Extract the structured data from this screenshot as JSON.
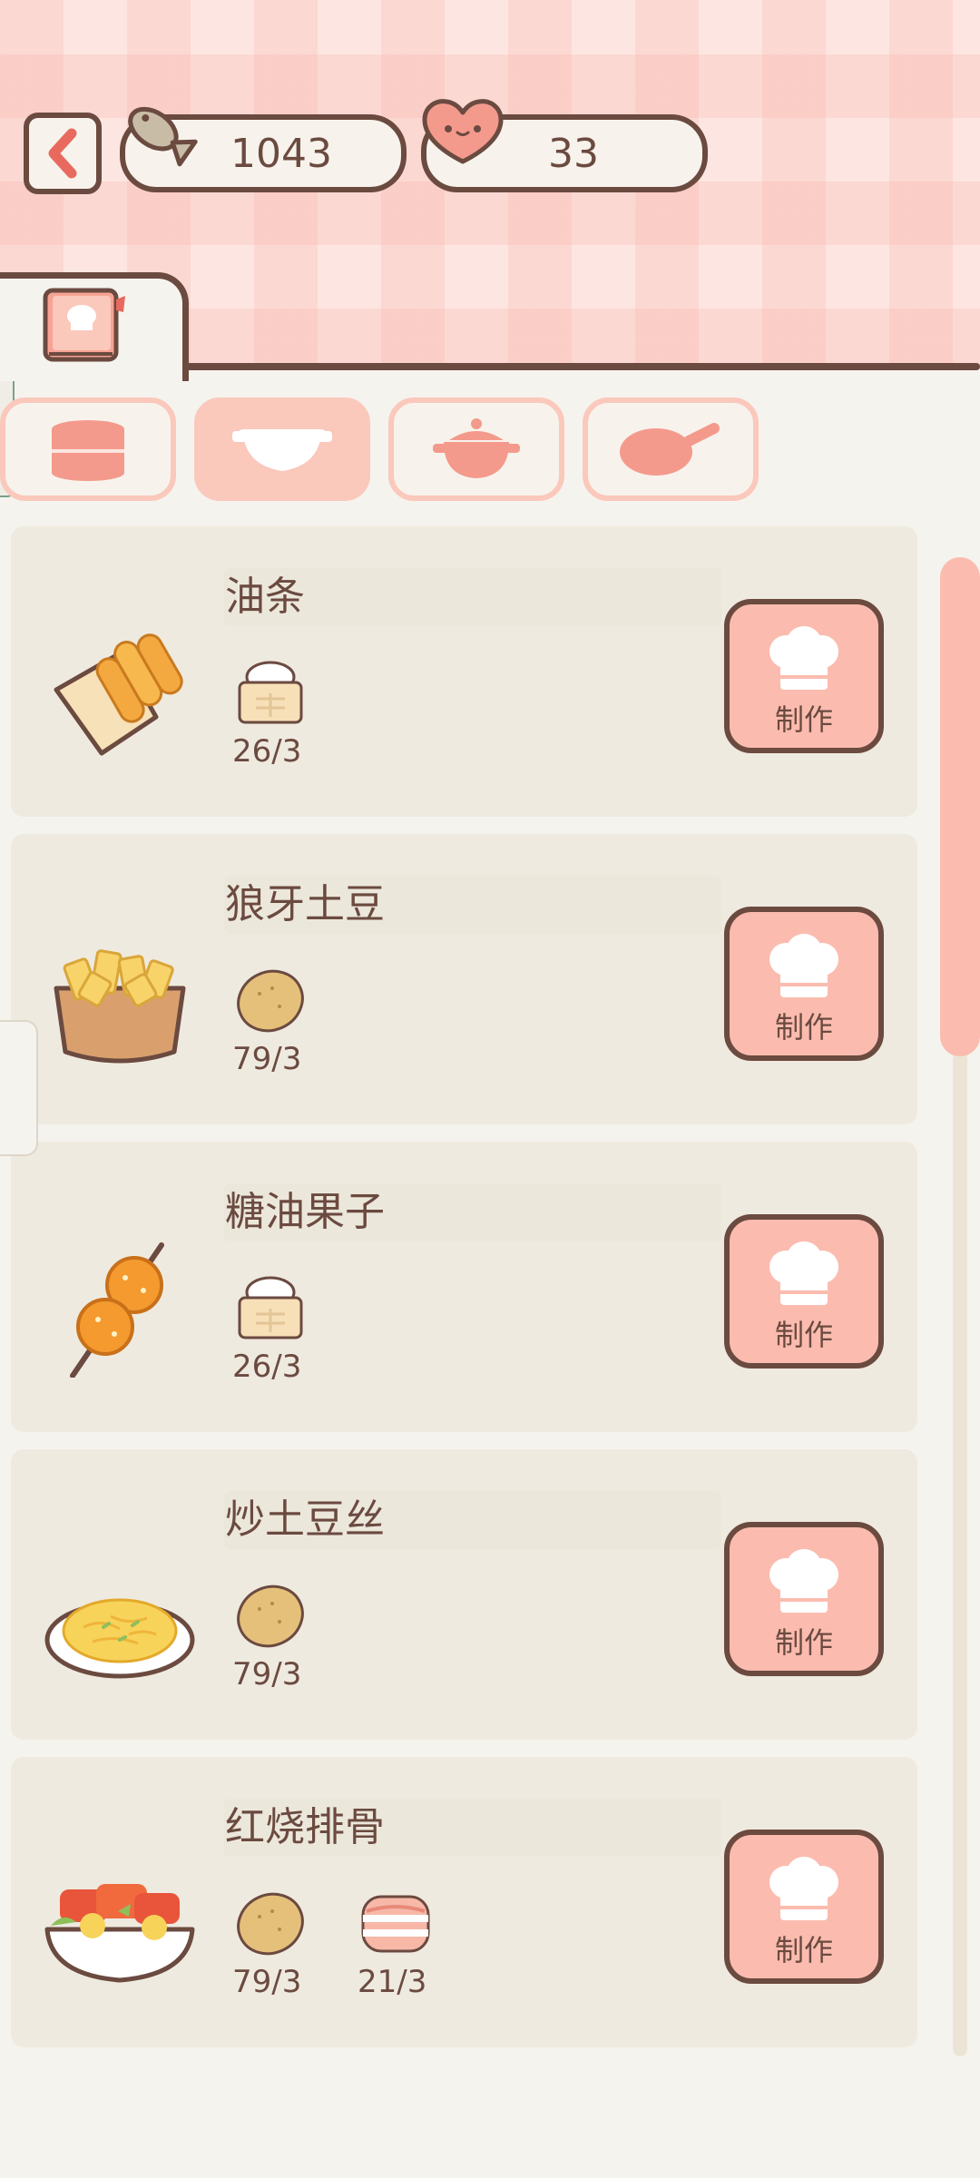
{
  "header": {
    "fish_count": "1043",
    "heart_count": "33"
  },
  "tabs": {
    "active_index": 1,
    "items": [
      "steamer-icon",
      "bowl-icon",
      "pot-icon",
      "pan-icon"
    ]
  },
  "recipes": [
    {
      "name": "油条",
      "food_icon": "youtiao-icon",
      "ingredients": [
        {
          "icon": "flour-icon",
          "count": "26/3"
        }
      ],
      "button": "制作"
    },
    {
      "name": "狼牙土豆",
      "food_icon": "potato-wedges-icon",
      "ingredients": [
        {
          "icon": "potato-icon",
          "count": "79/3"
        }
      ],
      "button": "制作"
    },
    {
      "name": "糖油果子",
      "food_icon": "sugar-fritter-skewer-icon",
      "ingredients": [
        {
          "icon": "flour-icon",
          "count": "26/3"
        }
      ],
      "button": "制作"
    },
    {
      "name": "炒土豆丝",
      "food_icon": "shredded-potato-plate-icon",
      "ingredients": [
        {
          "icon": "potato-icon",
          "count": "79/3"
        }
      ],
      "button": "制作"
    },
    {
      "name": "红烧排骨",
      "food_icon": "braised-ribs-bowl-icon",
      "ingredients": [
        {
          "icon": "potato-icon",
          "count": "79/3"
        },
        {
          "icon": "pork-icon",
          "count": "21/3"
        }
      ],
      "button": "制作"
    }
  ],
  "colors": {
    "outline": "#6b4a40",
    "accent_pink": "#fbbcaf",
    "card_bg": "#efeadf",
    "page_bg": "#f5f3ee"
  }
}
